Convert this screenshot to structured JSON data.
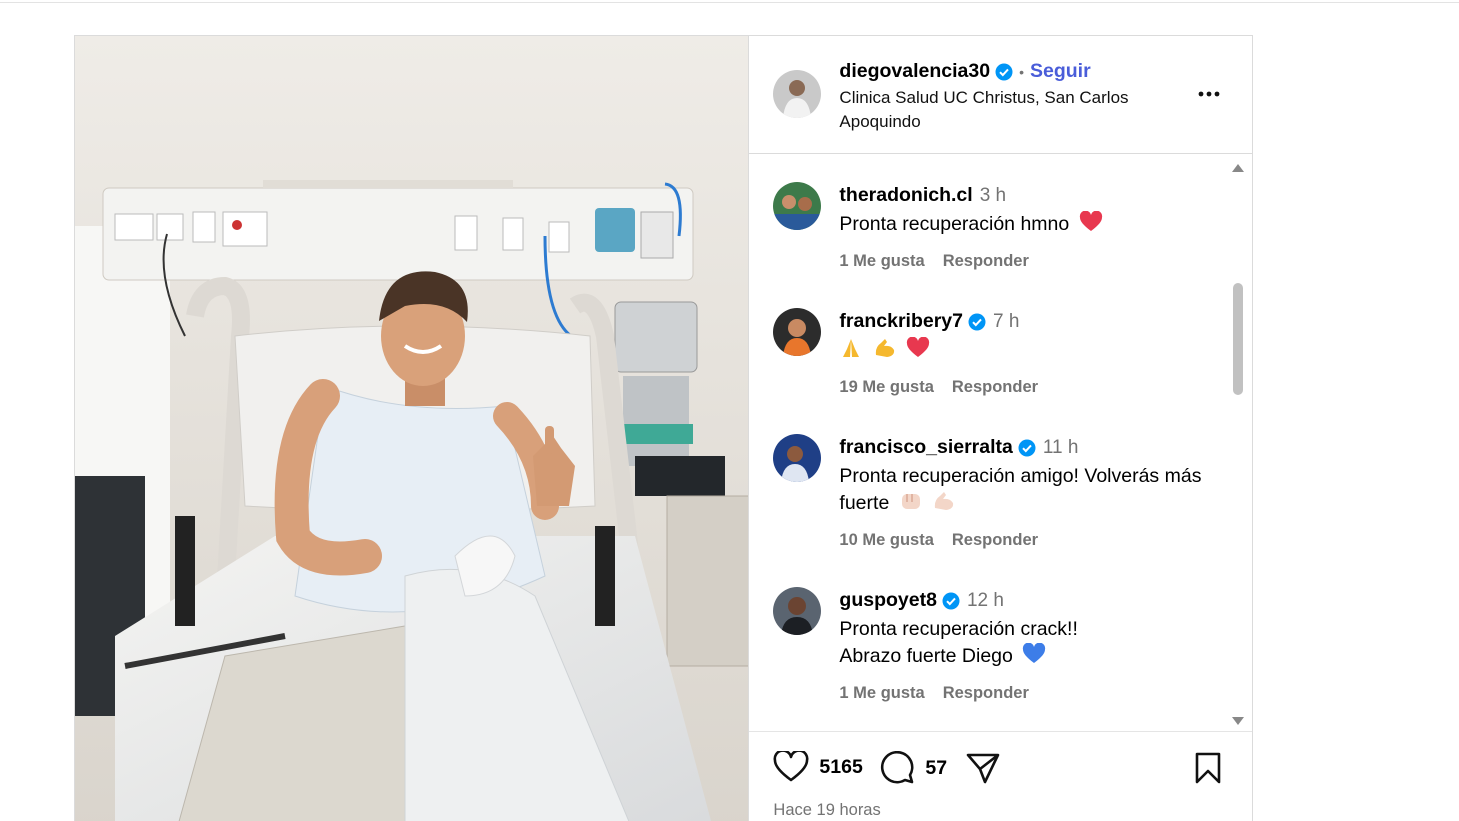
{
  "post": {
    "author": "diegovalencia30",
    "follow_label": "Seguir",
    "separator": "•",
    "location": "Clinica Salud UC Christus, San Carlos Apoquindo",
    "timestamp": "Hace 19 horas"
  },
  "comments": [
    {
      "user": "theradonich.cl",
      "verified": false,
      "time": "3 h",
      "text": "Pronta recuperación hmno",
      "emojis": [
        "heart"
      ],
      "likes": "1 Me gusta",
      "reply": "Responder"
    },
    {
      "user": "franckribery7",
      "verified": true,
      "time": "7 h",
      "text": "",
      "emojis": [
        "pray",
        "muscle",
        "heart"
      ],
      "likes": "19 Me gusta",
      "reply": "Responder"
    },
    {
      "user": "francisco_sierralta",
      "verified": true,
      "time": "11 h",
      "text": "Pronta recuperación amigo! Volverás más fuerte",
      "emojis": [
        "fist",
        "muscle-light"
      ],
      "likes": "10 Me gusta",
      "reply": "Responder"
    },
    {
      "user": "guspoyet8",
      "verified": true,
      "time": "12 h",
      "text": "Pronta recuperación crack!!",
      "text2": "Abrazo fuerte Diego",
      "emojis": [
        "blue-heart"
      ],
      "likes": "1 Me gusta",
      "reply": "Responder"
    }
  ],
  "stats": {
    "likes": "5165",
    "comments": "57"
  },
  "colors": {
    "follow": "#4a5dd9",
    "verified": "#0095f6",
    "muted": "#737373",
    "heart": "#ff3040"
  }
}
